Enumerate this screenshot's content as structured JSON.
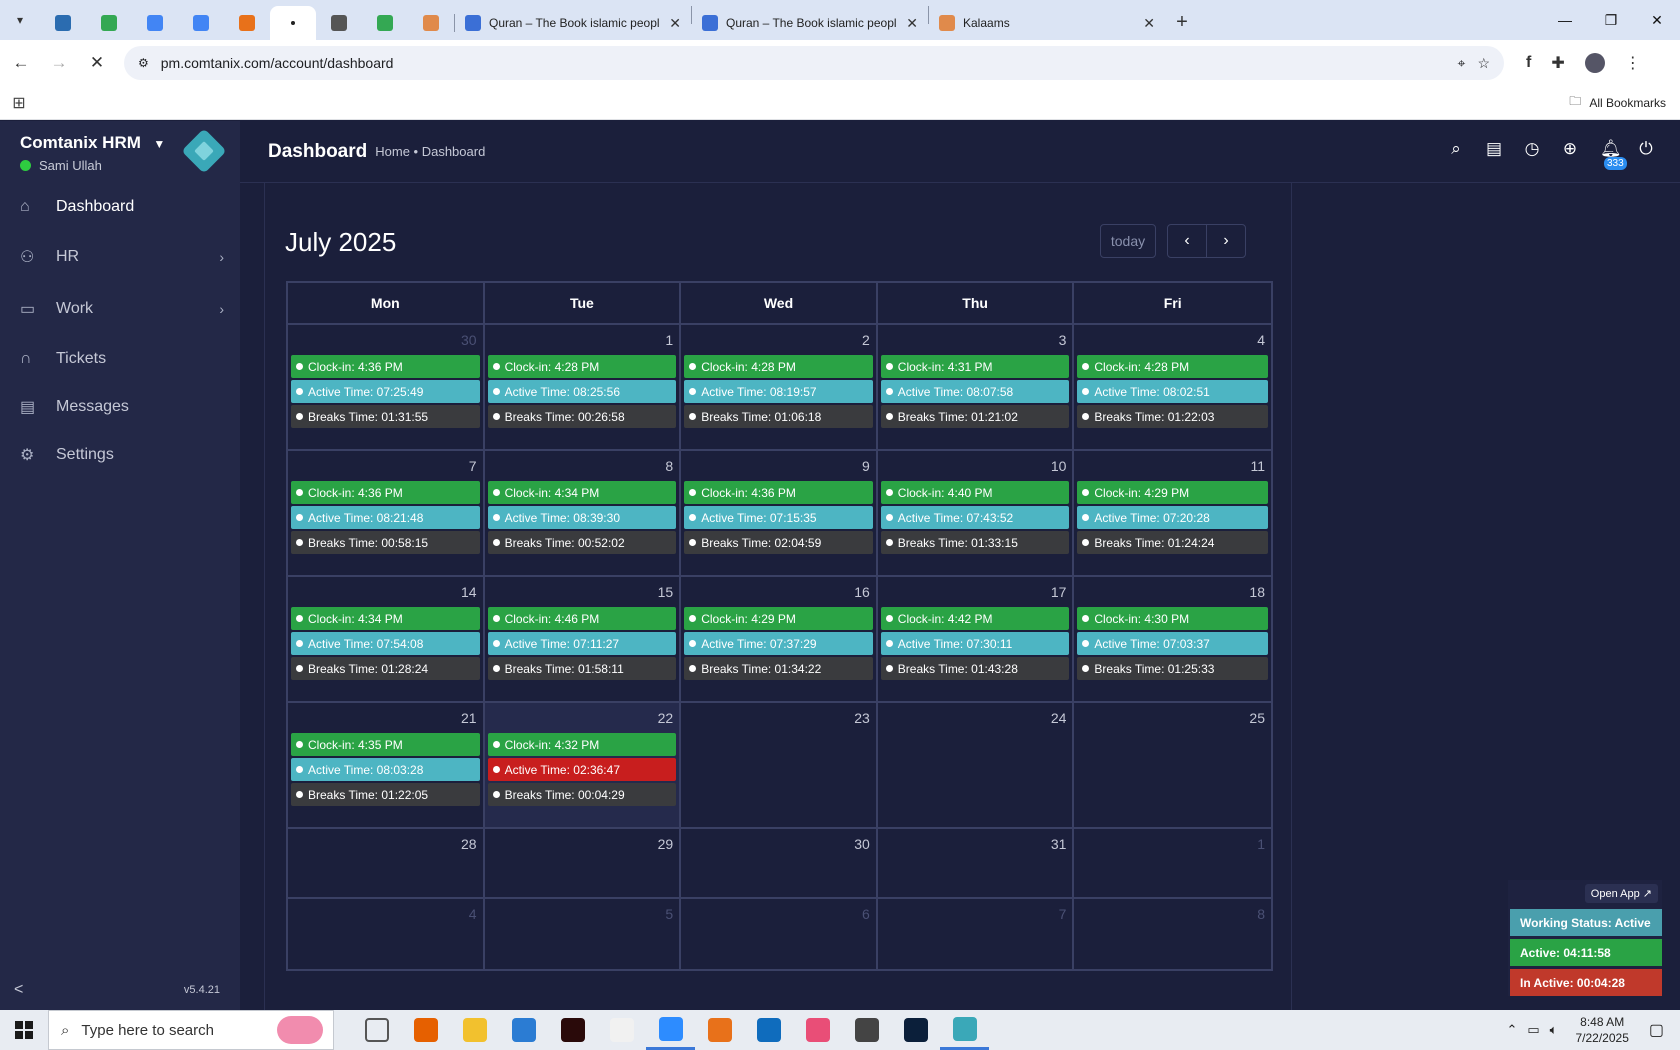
{
  "browser": {
    "tabs": [
      {
        "title": "Quran – The Book islamic peopl",
        "favicon_color": "#3b6fd6"
      },
      {
        "title": "Quran – The Book islamic peopl",
        "favicon_color": "#3b6fd6"
      },
      {
        "title": "Kalaams",
        "favicon_color": "#e08a4b"
      }
    ],
    "pinned_favicon_colors": [
      "#2b6cb0",
      "#34a853",
      "#4285f4",
      "#4285f4",
      "#e8711a",
      "#222222",
      "#555555",
      "#34a853",
      "#e08a4b"
    ],
    "url": "pm.comtanix.com/account/dashboard",
    "all_bookmarks": "All Bookmarks"
  },
  "sidebar": {
    "brand": "Comtanix HRM",
    "user": "Sami Ullah",
    "version": "v5.4.21",
    "items": [
      {
        "label": "Dashboard",
        "icon": "home-icon"
      },
      {
        "label": "HR",
        "icon": "users-icon"
      },
      {
        "label": "Work",
        "icon": "briefcase-icon"
      },
      {
        "label": "Tickets",
        "icon": "headset-icon"
      },
      {
        "label": "Messages",
        "icon": "message-icon"
      },
      {
        "label": "Settings",
        "icon": "gear-icon"
      }
    ]
  },
  "header": {
    "title": "Dashboard",
    "breadcrumb": "Home • Dashboard",
    "notification_count": "333"
  },
  "calendar": {
    "title": "July 2025",
    "today_label": "today",
    "day_headers": [
      "Mon",
      "Tue",
      "Wed",
      "Thu",
      "Fri"
    ],
    "weeks": [
      [
        {
          "day": "30",
          "muted": true,
          "clockin": "Clock-in: 4:36 PM",
          "active": "Active Time: 07:25:49",
          "breaks": "Breaks Time: 01:31:55"
        },
        {
          "day": "1",
          "clockin": "Clock-in: 4:28 PM",
          "active": "Active Time: 08:25:56",
          "breaks": "Breaks Time: 00:26:58"
        },
        {
          "day": "2",
          "clockin": "Clock-in: 4:28 PM",
          "active": "Active Time: 08:19:57",
          "breaks": "Breaks Time: 01:06:18"
        },
        {
          "day": "3",
          "clockin": "Clock-in: 4:31 PM",
          "active": "Active Time: 08:07:58",
          "breaks": "Breaks Time: 01:21:02"
        },
        {
          "day": "4",
          "clockin": "Clock-in: 4:28 PM",
          "active": "Active Time: 08:02:51",
          "breaks": "Breaks Time: 01:22:03"
        }
      ],
      [
        {
          "day": "7",
          "clockin": "Clock-in: 4:36 PM",
          "active": "Active Time: 08:21:48",
          "breaks": "Breaks Time: 00:58:15"
        },
        {
          "day": "8",
          "clockin": "Clock-in: 4:34 PM",
          "active": "Active Time: 08:39:30",
          "breaks": "Breaks Time: 00:52:02"
        },
        {
          "day": "9",
          "clockin": "Clock-in: 4:36 PM",
          "active": "Active Time: 07:15:35",
          "breaks": "Breaks Time: 02:04:59"
        },
        {
          "day": "10",
          "clockin": "Clock-in: 4:40 PM",
          "active": "Active Time: 07:43:52",
          "breaks": "Breaks Time: 01:33:15"
        },
        {
          "day": "11",
          "clockin": "Clock-in: 4:29 PM",
          "active": "Active Time: 07:20:28",
          "breaks": "Breaks Time: 01:24:24"
        }
      ],
      [
        {
          "day": "14",
          "clockin": "Clock-in: 4:34 PM",
          "active": "Active Time: 07:54:08",
          "breaks": "Breaks Time: 01:28:24"
        },
        {
          "day": "15",
          "clockin": "Clock-in: 4:46 PM",
          "active": "Active Time: 07:11:27",
          "breaks": "Breaks Time: 01:58:11"
        },
        {
          "day": "16",
          "clockin": "Clock-in: 4:29 PM",
          "active": "Active Time: 07:37:29",
          "breaks": "Breaks Time: 01:34:22"
        },
        {
          "day": "17",
          "clockin": "Clock-in: 4:42 PM",
          "active": "Active Time: 07:30:11",
          "breaks": "Breaks Time: 01:43:28"
        },
        {
          "day": "18",
          "clockin": "Clock-in: 4:30 PM",
          "active": "Active Time: 07:03:37",
          "breaks": "Breaks Time: 01:25:33"
        }
      ],
      [
        {
          "day": "21",
          "clockin": "Clock-in: 4:35 PM",
          "active": "Active Time: 08:03:28",
          "breaks": "Breaks Time: 01:22:05"
        },
        {
          "day": "22",
          "today": true,
          "clockin": "Clock-in: 4:32 PM",
          "active": "Active Time: 02:36:47",
          "active_alert": true,
          "breaks": "Breaks Time: 00:04:29"
        },
        {
          "day": "23"
        },
        {
          "day": "24"
        },
        {
          "day": "25"
        }
      ],
      [
        {
          "day": "28"
        },
        {
          "day": "29"
        },
        {
          "day": "30"
        },
        {
          "day": "31"
        },
        {
          "day": "1",
          "muted": true
        }
      ],
      [
        {
          "day": "4",
          "muted": true
        },
        {
          "day": "5",
          "muted": true
        },
        {
          "day": "6",
          "muted": true
        },
        {
          "day": "7",
          "muted": true
        },
        {
          "day": "8",
          "muted": true
        }
      ]
    ]
  },
  "status_widget": {
    "open_app": "Open App ↗",
    "working_status": "Working Status: Active",
    "active": "Active: 04:11:58",
    "inactive": "In Active: 00:04:28"
  },
  "taskbar": {
    "search_placeholder": "Type here to search",
    "time": "8:48 AM",
    "date": "7/22/2025",
    "app_colors": [
      "#555555",
      "#e66000",
      "#f2c12e",
      "#2b7cd3",
      "#2a0a0a",
      "#f1f1f1",
      "#2d8cff",
      "#e8711a",
      "#0f6cbd",
      "#e94e77",
      "#444444",
      "#0b1f3a",
      "#3aa8b8"
    ]
  }
}
